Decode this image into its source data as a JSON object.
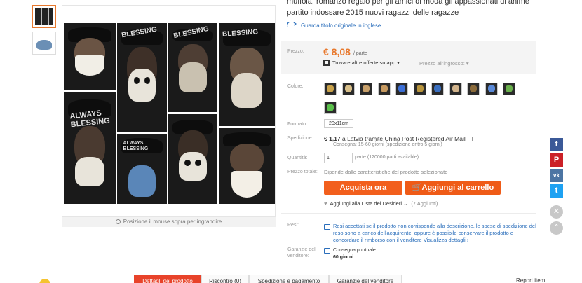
{
  "product": {
    "title_line1": "muffola, romanzo regalo per gli amici di moda gli appassionati di anime",
    "title_line2": "partito indossare 2015 nuovi ragazzi delle ragazze",
    "view_original": "Guarda titolo originale in inglese"
  },
  "gallery": {
    "hover_hint": "Posizione il mouse sopra per ingrandire",
    "tile_texts": [
      "BLESSING",
      "BLESSING",
      "BLESSING",
      "ALWAYS BLESSING",
      "ALWAYS BLESSING"
    ]
  },
  "price": {
    "label": "Prezzo:",
    "value": "€ 8,08",
    "unit": "/ parte",
    "offers": "Trovare altre offerte su app",
    "wholesale": "Prezzo all'ingrosso:"
  },
  "options": {
    "color_label": "Colore:",
    "swatch_colors": [
      "#c9a24a",
      "#d9c08a",
      "#c8a06a",
      "#c79a60",
      "#3c6fd6",
      "#b9953c",
      "#3a6fc0",
      "#d2b48c",
      "#8a6a3a",
      "#5a8ad8",
      "#6ab04c",
      "#5ac04a"
    ],
    "format_label": "Formato:",
    "format_value": "20x11cm"
  },
  "shipping": {
    "label": "Spedizione:",
    "price": "€ 1,17",
    "method": "a  Latvia tramite China Post Registered Air Mail",
    "note": "Consegna: 15-60 giorni (spedizione entro 5 giorni)"
  },
  "quantity": {
    "label": "Quantità:",
    "value": "1",
    "available": "parte (120000 parti available)"
  },
  "total": {
    "label": "Prezzo totale:",
    "note": "Dipende dalle caratteristiche del prodotto selezionato"
  },
  "actions": {
    "buy": "Acquista ora",
    "cart": "Aggiungi al carrello",
    "wishlist": "Aggiungi alla Lista dei Desideri",
    "wishlist_count": "(7 Aggiunti)"
  },
  "returns": {
    "label": "Resi:",
    "text": "Resi accettati se il prodotto non corrisponde alla descrizione, le spese di spedizione del reso sono a carico dell'acquirente; oppure è possibile conservare il prodotto e concordare il rimborso con il venditore",
    "link": "Visualizza dettagli ›"
  },
  "guarantee": {
    "label": "Garanzie del venditore:",
    "item": "Consegna puntuale",
    "days": "60 giorni"
  },
  "tabs": [
    "Dettagli del prodotto",
    "Riscontro (0)",
    "Spedizione e pagamento",
    "Garanzie del venditore"
  ],
  "report": "Report item",
  "social": [
    {
      "name": "facebook",
      "glyph": "f",
      "color": "#3b5998"
    },
    {
      "name": "pinterest",
      "glyph": "P",
      "color": "#cb2027"
    },
    {
      "name": "vk",
      "glyph": "vk",
      "color": "#4c75a3"
    },
    {
      "name": "twitter",
      "glyph": "t",
      "color": "#1da1f2"
    }
  ]
}
